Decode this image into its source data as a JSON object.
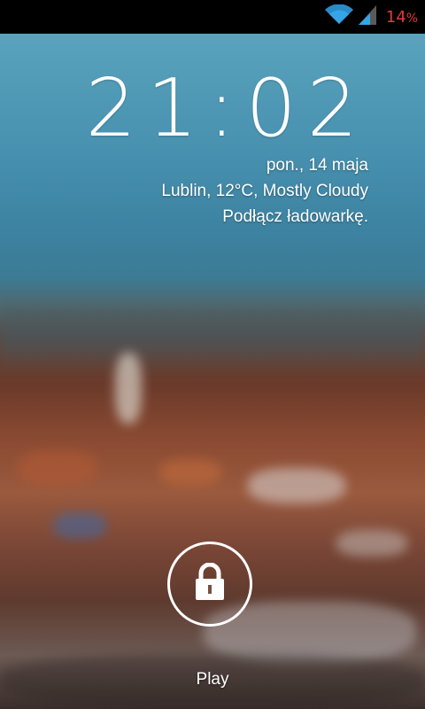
{
  "status_bar": {
    "wifi_icon": "wifi-icon",
    "signal_icon": "cell-signal-icon",
    "battery_level": "14",
    "battery_percent_sign": "%",
    "battery_color": "#e53935"
  },
  "lockscreen": {
    "time": "21:02",
    "date": "pon., 14 maja",
    "weather": "Lublin, 12°C, Mostly Cloudy",
    "charging": "Podłącz ładowarkę.",
    "lock_icon": "padlock-icon",
    "target_label": "Play"
  }
}
